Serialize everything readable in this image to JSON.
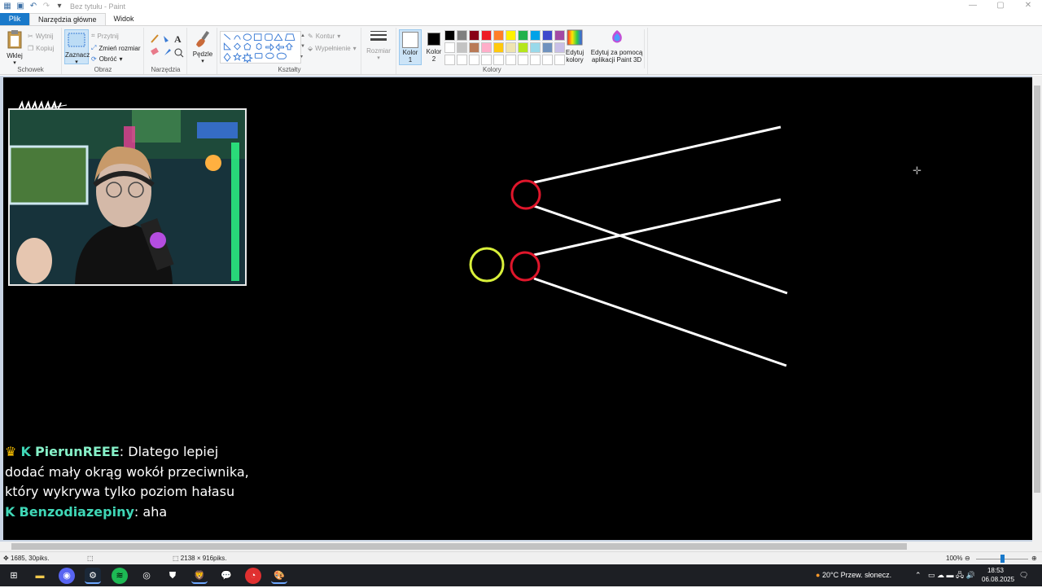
{
  "window": {
    "title": "Bez tytułu - Paint",
    "controls": [
      "—",
      "▢",
      "✕"
    ]
  },
  "tabs": [
    {
      "label": "Plik"
    },
    {
      "label": "Narzędzia główne"
    },
    {
      "label": "Widok"
    }
  ],
  "ribbon": {
    "clipboard": {
      "paste": "Wklej",
      "cut": "Wytnij",
      "copy": "Kopiuj",
      "group": "Schowek"
    },
    "image": {
      "select": "Zaznacz",
      "crop": "Przytnij",
      "resize": "Zmień rozmiar",
      "rotate": "Obróć",
      "group": "Obraz"
    },
    "tools": {
      "group": "Narzędzia"
    },
    "brushes": {
      "label": "Pędzle"
    },
    "shapes": {
      "outline": "Kontur",
      "fill": "Wypełnienie",
      "group": "Kształty"
    },
    "size": {
      "label": "Rozmiar"
    },
    "color1": {
      "label": "Kolor",
      "num": "1"
    },
    "color2": {
      "label": "Kolor",
      "num": "2"
    },
    "colors_group": "Kolory",
    "edit_colors": {
      "line1": "Edytuj",
      "line2": "kolory"
    },
    "paint3d": {
      "line1": "Edytuj za pomocą",
      "line2": "aplikacji Paint 3D"
    },
    "palette": [
      "#000000",
      "#7f7f7f",
      "#880015",
      "#ed1c24",
      "#ff7f27",
      "#fff200",
      "#22b14c",
      "#00a2e8",
      "#3f48cc",
      "#a349a4",
      "#ffffff",
      "#c3c3c3",
      "#b97a57",
      "#ffaec9",
      "#ffc90e",
      "#efe4b0",
      "#b5e61d",
      "#99d9ea",
      "#7092be",
      "#c8bfe7",
      "#ffffff",
      "#ffffff",
      "#ffffff",
      "#ffffff",
      "#ffffff",
      "#ffffff",
      "#ffffff",
      "#ffffff",
      "#ffffff",
      "#ffffff"
    ]
  },
  "canvas": {
    "webcam_logo": "mmm",
    "chat": [
      {
        "user": "PierunREEE",
        "message": ": Dlatego lepiej",
        "continued": [
          "dodać mały okrąg wokół przeciwnika,",
          "który wykrywa tylko poziom hałasu"
        ]
      },
      {
        "user": "Benzodiazepiny",
        "message": ": aha"
      }
    ],
    "drawing_colors": {
      "red_circle": "#e0162b",
      "yellow_circle": "#d9f03a",
      "lines": "#ffffff"
    }
  },
  "status": {
    "cursor_pos": "1685, 30piks.",
    "canvas_size": "2138 × 916piks.",
    "zoom": "100%"
  },
  "taskbar": {
    "weather": "20°C  Przew. słonecz.",
    "time": "18:53",
    "date": "06.08.2025"
  }
}
